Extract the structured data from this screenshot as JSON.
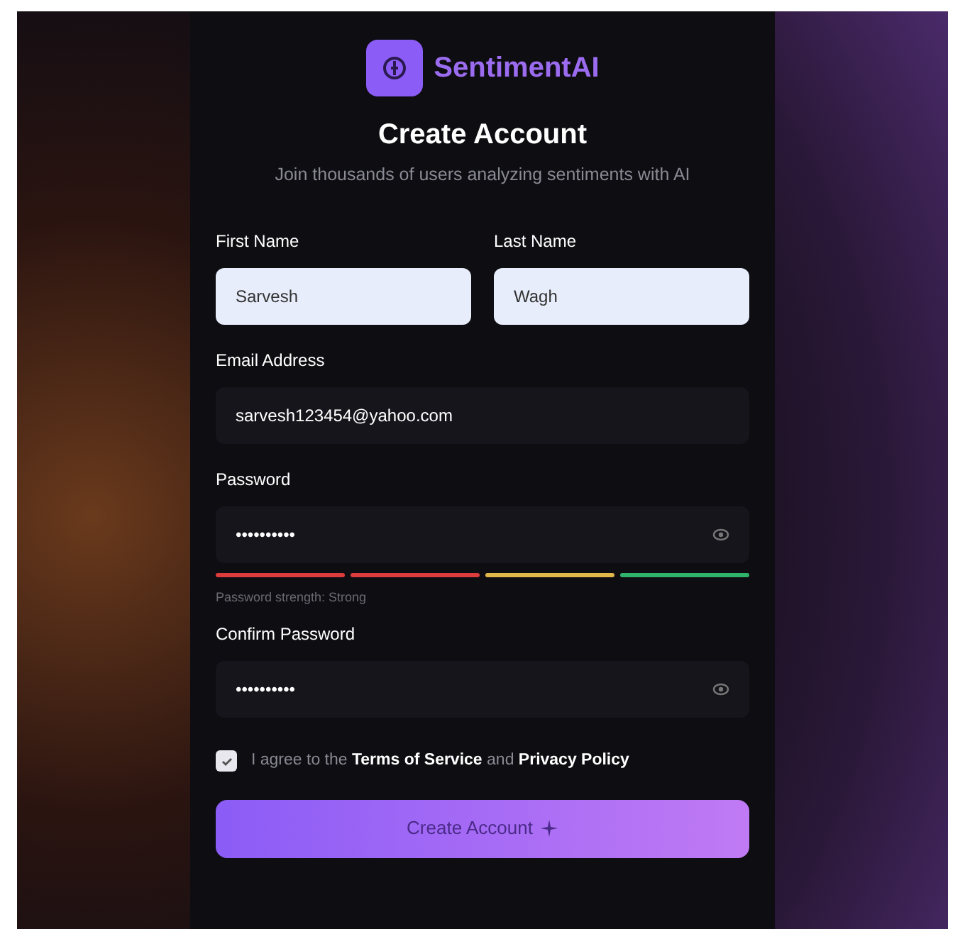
{
  "brand": {
    "name": "SentimentAI"
  },
  "heading": "Create Account",
  "subheading": "Join thousands of users analyzing sentiments with AI",
  "name_fields": [
    {
      "label": "First Name",
      "value": "Sarvesh",
      "autofilled": true
    },
    {
      "label": "Last Name",
      "value": "Wagh",
      "autofilled": true
    }
  ],
  "email": {
    "label": "Email Address",
    "value": "sarvesh123454@yahoo.com",
    "autofilled": false
  },
  "password": {
    "label": "Password",
    "value": "••••••••••"
  },
  "strength": {
    "segments": [
      {
        "color": "#dc3c3c"
      },
      {
        "color": "#dc3c3c"
      },
      {
        "color": "#e0b84a"
      },
      {
        "color": "#2fb36a"
      }
    ],
    "text": "Password strength: Strong"
  },
  "confirm_password": {
    "label": "Confirm Password",
    "value": "••••••••••"
  },
  "terms": {
    "checked": true,
    "parts": [
      {
        "kind": "text",
        "text": "I agree to the"
      },
      {
        "kind": "link",
        "text": "Terms of Service"
      },
      {
        "kind": "text",
        "text": "and"
      },
      {
        "kind": "link",
        "text": "Privacy Policy"
      }
    ]
  },
  "submit": {
    "label": "Create Account"
  }
}
